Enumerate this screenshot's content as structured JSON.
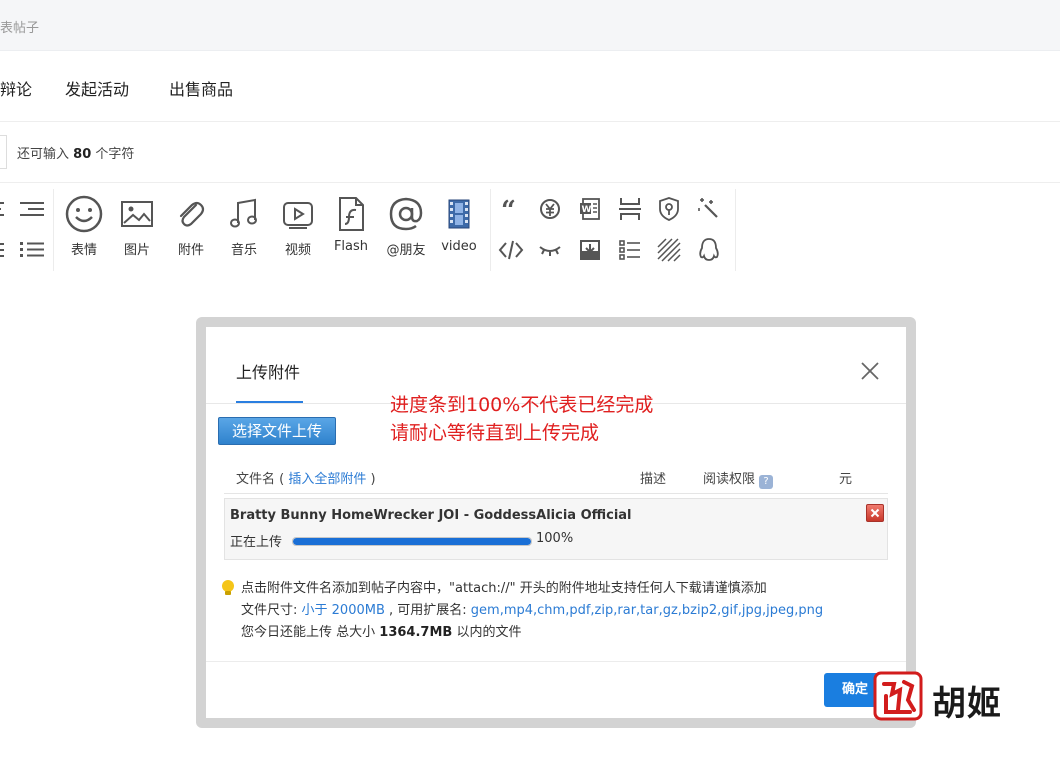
{
  "topbar": {
    "crumb": "表帖子"
  },
  "tabs": [
    {
      "label": "辩论"
    },
    {
      "label": "发起活动"
    },
    {
      "label": "出售商品"
    }
  ],
  "char_count": {
    "prefix": "还可输入",
    "count": "80",
    "suffix": "个字符"
  },
  "toolbar": {
    "buttons": [
      {
        "icon": "smiley-icon",
        "label": "表情"
      },
      {
        "icon": "image-icon",
        "label": "图片"
      },
      {
        "icon": "paperclip-icon",
        "label": "附件"
      },
      {
        "icon": "music-icon",
        "label": "音乐"
      },
      {
        "icon": "video-play-icon",
        "label": "视频"
      },
      {
        "icon": "flash-icon",
        "label": "Flash"
      },
      {
        "icon": "at-sign-icon",
        "label": "@朋友"
      },
      {
        "icon": "film-icon",
        "label": "video"
      }
    ]
  },
  "dialog": {
    "title": "上传附件",
    "notice_line1": "进度条到100%不代表已经完成",
    "notice_line2": "请耐心等待直到上传完成",
    "upload_button": "选择文件上传",
    "columns": {
      "file_prefix": "文件名 (",
      "insert_all": "插入全部附件",
      "file_suffix": ")",
      "desc": "描述",
      "perm": "阅读权限",
      "perm_help": "?",
      "price": "元"
    },
    "file": {
      "name": "Bratty Bunny HomeWrecker JOI - GoddessAlicia Official",
      "status": "正在上传",
      "progress": 100,
      "progress_label": "100%"
    },
    "tips": {
      "line1": "点击附件文件名添加到帖子内容中，\"attach://\" 开头的附件地址支持任何人下载请谨慎添加",
      "size_label": "文件尺寸: ",
      "size_limit": "小于 2000MB",
      "ext_label": " , 可用扩展名: ",
      "extensions": "gem,mp4,chm,pdf,zip,rar,tar,gz,bzip2,gif,jpg,jpeg,png",
      "quota_prefix": "您今日还能上传 总大小",
      "quota_value": "1364.7MB",
      "quota_suffix": "以内的文件"
    },
    "confirm_button": "确定"
  },
  "watermark": {
    "text": "胡姬"
  },
  "colors": {
    "accent": "#1a7ee0",
    "link": "#2b7bd4",
    "notice": "#e02020",
    "progress": "#1a6fd6"
  }
}
